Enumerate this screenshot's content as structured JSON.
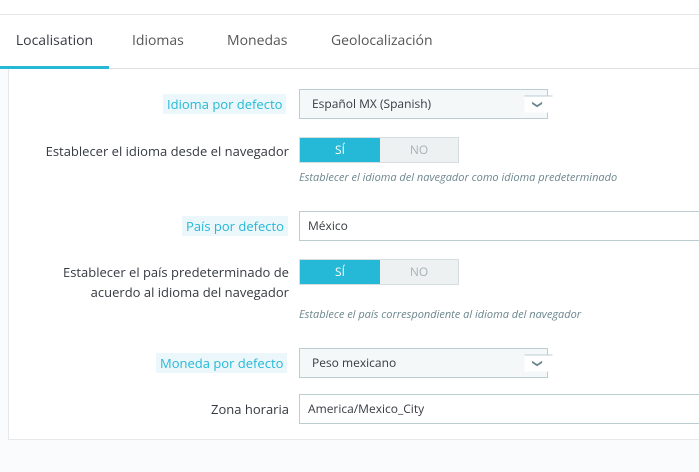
{
  "tabs": [
    {
      "label": "Localisation"
    },
    {
      "label": "Idiomas"
    },
    {
      "label": "Monedas"
    },
    {
      "label": "Geolocalización"
    }
  ],
  "form": {
    "default_language": {
      "label": "Idioma por defecto",
      "value": "Español MX (Spanish)"
    },
    "browser_language": {
      "label": "Establecer el idioma desde el navegador",
      "on": "SÍ",
      "off": "NO",
      "help": "Establecer el idioma del navegador como idioma predeterminado"
    },
    "default_country": {
      "label": "País por defecto",
      "value": "México"
    },
    "browser_country": {
      "label_line1": "Establecer el país predeterminado de",
      "label_line2": "acuerdo al idioma del navegador",
      "on": "SÍ",
      "off": "NO",
      "help": "Establece el país correspondiente al idioma del navegador"
    },
    "default_currency": {
      "label": "Moneda por defecto",
      "value": "Peso mexicano"
    },
    "timezone": {
      "label": "Zona horaria",
      "value": "America/Mexico_City"
    }
  },
  "colors": {
    "accent": "#25b9d7"
  }
}
